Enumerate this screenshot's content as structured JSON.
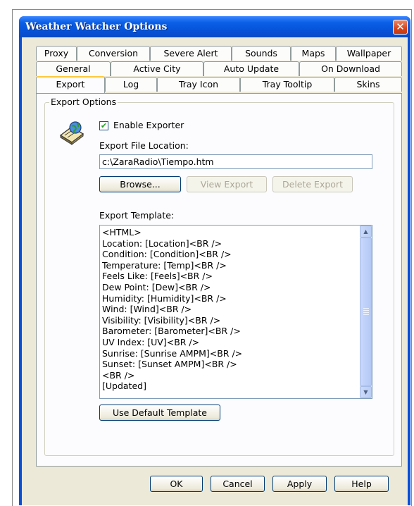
{
  "window": {
    "title": "Weather Watcher Options",
    "close_glyph": "✕"
  },
  "tabs": {
    "row1": [
      "Proxy",
      "Conversion",
      "Severe Alert",
      "Sounds",
      "Maps",
      "Wallpaper"
    ],
    "row2": [
      "General",
      "Active City",
      "Auto Update",
      "On Download"
    ],
    "row3": [
      "Export",
      "Log",
      "Tray Icon",
      "Tray Tooltip",
      "Skins"
    ],
    "active": "Export"
  },
  "export_options": {
    "group_label": "Export Options",
    "icon": "export-globe-icon",
    "enable_label": "Enable Exporter",
    "enable_checked": true,
    "check_glyph": "✔",
    "file_location_label": "Export File Location:",
    "file_location_value": "c:\\ZaraRadio\\Tiempo.htm",
    "browse_label": "Browse...",
    "view_label": "View Export",
    "delete_label": "Delete Export",
    "template_label": "Export Template:",
    "template_lines": [
      "<HTML>",
      "Location: [Location]<BR />",
      "Condition: [Condition]<BR />",
      "Temperature: [Temp]<BR />",
      "Feels Like: [Feels]<BR />",
      "Dew Point: [Dew]<BR />",
      "Humidity: [Humidity]<BR />",
      "Wind: [Wind]<BR />",
      "Visibility: [Visibility]<BR />",
      "Barometer: [Barometer]<BR />",
      "UV Index: [UV]<BR />",
      "Sunrise: [Sunrise AMPM]<BR />",
      "Sunset: [Sunset AMPM]<BR />",
      "<BR />",
      "[Updated]"
    ],
    "default_template_label": "Use Default Template"
  },
  "footer": {
    "ok": "OK",
    "cancel": "Cancel",
    "apply": "Apply",
    "help": "Help"
  }
}
